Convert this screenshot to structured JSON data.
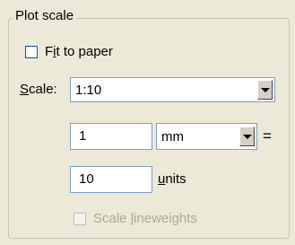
{
  "plot_scale": {
    "group_title": "Plot scale",
    "fit_to_paper": {
      "label_prefix": "F",
      "label_accel": "i",
      "label_rest": "t to paper",
      "checked": false
    },
    "scale": {
      "label_accel": "S",
      "label_rest": "cale:",
      "selected": "1:10"
    },
    "paper_units_value": "1",
    "units_combo": {
      "selected": "mm"
    },
    "equals": "=",
    "drawing_units_value": "10",
    "units_label": {
      "accel": "u",
      "rest": "nits"
    },
    "scale_lineweights": {
      "label_prefix": "Scale ",
      "label_accel": "l",
      "label_rest": "ineweights",
      "checked": false,
      "enabled": false
    }
  },
  "icons": [
    "chevron-down-icon"
  ],
  "colors": {
    "dialog_bg": "#ece9d8",
    "field_border": "#7f9db9",
    "disabled_text": "#aca899"
  }
}
